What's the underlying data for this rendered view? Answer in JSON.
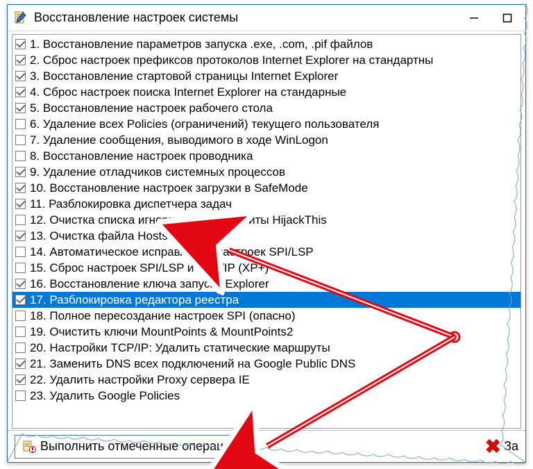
{
  "window": {
    "title": "Восстановление настроек системы"
  },
  "items": [
    {
      "checked": true,
      "label": "1. Восстановление параметров запуска .exe, .com, .pif файлов"
    },
    {
      "checked": true,
      "label": "2. Сброс настроек префиксов протоколов Internet Explorer на стандартны"
    },
    {
      "checked": true,
      "label": "3. Восстановление стартовой страницы Internet Explorer"
    },
    {
      "checked": true,
      "label": "4. Сброс настроек поиска Internet Explorer на стандарные"
    },
    {
      "checked": true,
      "label": "5. Восстановление настроек рабочего стола"
    },
    {
      "checked": false,
      "label": "6. Удаление всех Policies (ограничений) текущего пользователя"
    },
    {
      "checked": false,
      "label": "7. Удаление сообщения, выводимого в ходе WinLogon"
    },
    {
      "checked": false,
      "label": "8. Восстановление настроек проводника"
    },
    {
      "checked": true,
      "label": "9. Удаление отладчиков системных процессов"
    },
    {
      "checked": true,
      "label": "10. Восстановление настроек загрузки в SafeMode"
    },
    {
      "checked": true,
      "label": "11. Разблокировка диспетчера задач"
    },
    {
      "checked": false,
      "label": "12. Очистка списка игнорирования утилиты HijackThis"
    },
    {
      "checked": true,
      "label": "13. Очистка файла Hosts"
    },
    {
      "checked": false,
      "label": "14. Автоматическое исправление настроек SPI/LSP"
    },
    {
      "checked": false,
      "label": "15. Сброс настроек SPI/LSP и TCP/IP (XP+)"
    },
    {
      "checked": true,
      "label": "16. Восстановление ключа запуска Explorer"
    },
    {
      "checked": true,
      "label": "17. Разблокировка редактора реестра",
      "selected": true
    },
    {
      "checked": false,
      "label": "18. Полное пересоздание настроек SPI (опасно)"
    },
    {
      "checked": false,
      "label": "19. Очистить ключи MountPoints & MountPoints2"
    },
    {
      "checked": false,
      "label": "20. Настройки TCP/IP: Удалить статические маршруты"
    },
    {
      "checked": true,
      "label": "21. Заменить DNS всех подключений на Google Public DNS"
    },
    {
      "checked": true,
      "label": "22. Удалить настройки Proxy сервера IE"
    },
    {
      "checked": false,
      "label": "23. Удалить Google Policies"
    }
  ],
  "buttons": {
    "run": "Выполнить отмеченные операции",
    "cancel": "За"
  }
}
